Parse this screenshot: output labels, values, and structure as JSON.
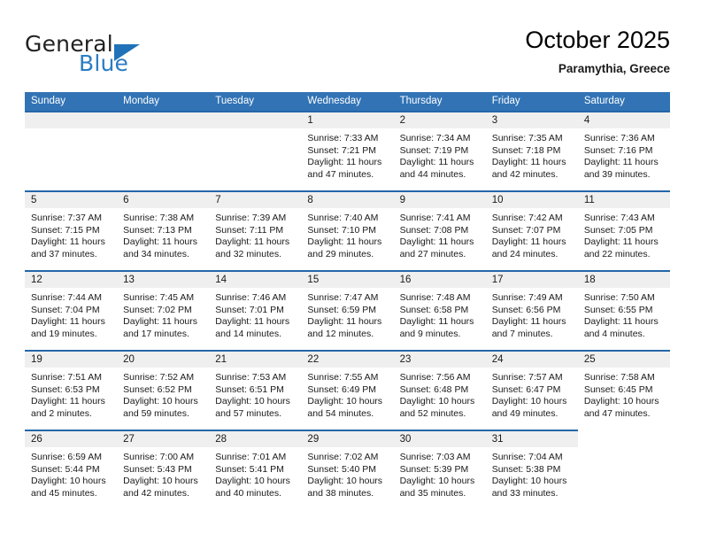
{
  "brand": {
    "line1": "General",
    "line2": "Blue",
    "triangle_icon": "triangle-icon",
    "color_dark": "#222222",
    "color_blue": "#2b7cc4"
  },
  "header": {
    "title": "October 2025",
    "subtitle": "Paramythia, Greece"
  },
  "theme": {
    "header_blue": "#3273b5",
    "row_rule_blue": "#2566a8",
    "day_band_gray": "#efefef"
  },
  "weekdays": [
    "Sunday",
    "Monday",
    "Tuesday",
    "Wednesday",
    "Thursday",
    "Friday",
    "Saturday"
  ],
  "weeks": [
    [
      {
        "day": "",
        "blank": true,
        "sunrise": "",
        "sunset": "",
        "daylight_line1": "",
        "daylight_line2": ""
      },
      {
        "day": "",
        "blank": true,
        "sunrise": "",
        "sunset": "",
        "daylight_line1": "",
        "daylight_line2": ""
      },
      {
        "day": "",
        "blank": true,
        "sunrise": "",
        "sunset": "",
        "daylight_line1": "",
        "daylight_line2": ""
      },
      {
        "day": "1",
        "blank": false,
        "sunrise": "Sunrise: 7:33 AM",
        "sunset": "Sunset: 7:21 PM",
        "daylight_line1": "Daylight: 11 hours",
        "daylight_line2": "and 47 minutes."
      },
      {
        "day": "2",
        "blank": false,
        "sunrise": "Sunrise: 7:34 AM",
        "sunset": "Sunset: 7:19 PM",
        "daylight_line1": "Daylight: 11 hours",
        "daylight_line2": "and 44 minutes."
      },
      {
        "day": "3",
        "blank": false,
        "sunrise": "Sunrise: 7:35 AM",
        "sunset": "Sunset: 7:18 PM",
        "daylight_line1": "Daylight: 11 hours",
        "daylight_line2": "and 42 minutes."
      },
      {
        "day": "4",
        "blank": false,
        "sunrise": "Sunrise: 7:36 AM",
        "sunset": "Sunset: 7:16 PM",
        "daylight_line1": "Daylight: 11 hours",
        "daylight_line2": "and 39 minutes."
      }
    ],
    [
      {
        "day": "5",
        "blank": false,
        "sunrise": "Sunrise: 7:37 AM",
        "sunset": "Sunset: 7:15 PM",
        "daylight_line1": "Daylight: 11 hours",
        "daylight_line2": "and 37 minutes."
      },
      {
        "day": "6",
        "blank": false,
        "sunrise": "Sunrise: 7:38 AM",
        "sunset": "Sunset: 7:13 PM",
        "daylight_line1": "Daylight: 11 hours",
        "daylight_line2": "and 34 minutes."
      },
      {
        "day": "7",
        "blank": false,
        "sunrise": "Sunrise: 7:39 AM",
        "sunset": "Sunset: 7:11 PM",
        "daylight_line1": "Daylight: 11 hours",
        "daylight_line2": "and 32 minutes."
      },
      {
        "day": "8",
        "blank": false,
        "sunrise": "Sunrise: 7:40 AM",
        "sunset": "Sunset: 7:10 PM",
        "daylight_line1": "Daylight: 11 hours",
        "daylight_line2": "and 29 minutes."
      },
      {
        "day": "9",
        "blank": false,
        "sunrise": "Sunrise: 7:41 AM",
        "sunset": "Sunset: 7:08 PM",
        "daylight_line1": "Daylight: 11 hours",
        "daylight_line2": "and 27 minutes."
      },
      {
        "day": "10",
        "blank": false,
        "sunrise": "Sunrise: 7:42 AM",
        "sunset": "Sunset: 7:07 PM",
        "daylight_line1": "Daylight: 11 hours",
        "daylight_line2": "and 24 minutes."
      },
      {
        "day": "11",
        "blank": false,
        "sunrise": "Sunrise: 7:43 AM",
        "sunset": "Sunset: 7:05 PM",
        "daylight_line1": "Daylight: 11 hours",
        "daylight_line2": "and 22 minutes."
      }
    ],
    [
      {
        "day": "12",
        "blank": false,
        "sunrise": "Sunrise: 7:44 AM",
        "sunset": "Sunset: 7:04 PM",
        "daylight_line1": "Daylight: 11 hours",
        "daylight_line2": "and 19 minutes."
      },
      {
        "day": "13",
        "blank": false,
        "sunrise": "Sunrise: 7:45 AM",
        "sunset": "Sunset: 7:02 PM",
        "daylight_line1": "Daylight: 11 hours",
        "daylight_line2": "and 17 minutes."
      },
      {
        "day": "14",
        "blank": false,
        "sunrise": "Sunrise: 7:46 AM",
        "sunset": "Sunset: 7:01 PM",
        "daylight_line1": "Daylight: 11 hours",
        "daylight_line2": "and 14 minutes."
      },
      {
        "day": "15",
        "blank": false,
        "sunrise": "Sunrise: 7:47 AM",
        "sunset": "Sunset: 6:59 PM",
        "daylight_line1": "Daylight: 11 hours",
        "daylight_line2": "and 12 minutes."
      },
      {
        "day": "16",
        "blank": false,
        "sunrise": "Sunrise: 7:48 AM",
        "sunset": "Sunset: 6:58 PM",
        "daylight_line1": "Daylight: 11 hours",
        "daylight_line2": "and 9 minutes."
      },
      {
        "day": "17",
        "blank": false,
        "sunrise": "Sunrise: 7:49 AM",
        "sunset": "Sunset: 6:56 PM",
        "daylight_line1": "Daylight: 11 hours",
        "daylight_line2": "and 7 minutes."
      },
      {
        "day": "18",
        "blank": false,
        "sunrise": "Sunrise: 7:50 AM",
        "sunset": "Sunset: 6:55 PM",
        "daylight_line1": "Daylight: 11 hours",
        "daylight_line2": "and 4 minutes."
      }
    ],
    [
      {
        "day": "19",
        "blank": false,
        "sunrise": "Sunrise: 7:51 AM",
        "sunset": "Sunset: 6:53 PM",
        "daylight_line1": "Daylight: 11 hours",
        "daylight_line2": "and 2 minutes."
      },
      {
        "day": "20",
        "blank": false,
        "sunrise": "Sunrise: 7:52 AM",
        "sunset": "Sunset: 6:52 PM",
        "daylight_line1": "Daylight: 10 hours",
        "daylight_line2": "and 59 minutes."
      },
      {
        "day": "21",
        "blank": false,
        "sunrise": "Sunrise: 7:53 AM",
        "sunset": "Sunset: 6:51 PM",
        "daylight_line1": "Daylight: 10 hours",
        "daylight_line2": "and 57 minutes."
      },
      {
        "day": "22",
        "blank": false,
        "sunrise": "Sunrise: 7:55 AM",
        "sunset": "Sunset: 6:49 PM",
        "daylight_line1": "Daylight: 10 hours",
        "daylight_line2": "and 54 minutes."
      },
      {
        "day": "23",
        "blank": false,
        "sunrise": "Sunrise: 7:56 AM",
        "sunset": "Sunset: 6:48 PM",
        "daylight_line1": "Daylight: 10 hours",
        "daylight_line2": "and 52 minutes."
      },
      {
        "day": "24",
        "blank": false,
        "sunrise": "Sunrise: 7:57 AM",
        "sunset": "Sunset: 6:47 PM",
        "daylight_line1": "Daylight: 10 hours",
        "daylight_line2": "and 49 minutes."
      },
      {
        "day": "25",
        "blank": false,
        "sunrise": "Sunrise: 7:58 AM",
        "sunset": "Sunset: 6:45 PM",
        "daylight_line1": "Daylight: 10 hours",
        "daylight_line2": "and 47 minutes."
      }
    ],
    [
      {
        "day": "26",
        "blank": false,
        "sunrise": "Sunrise: 6:59 AM",
        "sunset": "Sunset: 5:44 PM",
        "daylight_line1": "Daylight: 10 hours",
        "daylight_line2": "and 45 minutes."
      },
      {
        "day": "27",
        "blank": false,
        "sunrise": "Sunrise: 7:00 AM",
        "sunset": "Sunset: 5:43 PM",
        "daylight_line1": "Daylight: 10 hours",
        "daylight_line2": "and 42 minutes."
      },
      {
        "day": "28",
        "blank": false,
        "sunrise": "Sunrise: 7:01 AM",
        "sunset": "Sunset: 5:41 PM",
        "daylight_line1": "Daylight: 10 hours",
        "daylight_line2": "and 40 minutes."
      },
      {
        "day": "29",
        "blank": false,
        "sunrise": "Sunrise: 7:02 AM",
        "sunset": "Sunset: 5:40 PM",
        "daylight_line1": "Daylight: 10 hours",
        "daylight_line2": "and 38 minutes."
      },
      {
        "day": "30",
        "blank": false,
        "sunrise": "Sunrise: 7:03 AM",
        "sunset": "Sunset: 5:39 PM",
        "daylight_line1": "Daylight: 10 hours",
        "daylight_line2": "and 35 minutes."
      },
      {
        "day": "31",
        "blank": false,
        "sunrise": "Sunrise: 7:04 AM",
        "sunset": "Sunset: 5:38 PM",
        "daylight_line1": "Daylight: 10 hours",
        "daylight_line2": "and 33 minutes."
      },
      {
        "day": "",
        "blank": true,
        "sunrise": "",
        "sunset": "",
        "daylight_line1": "",
        "daylight_line2": ""
      }
    ]
  ]
}
